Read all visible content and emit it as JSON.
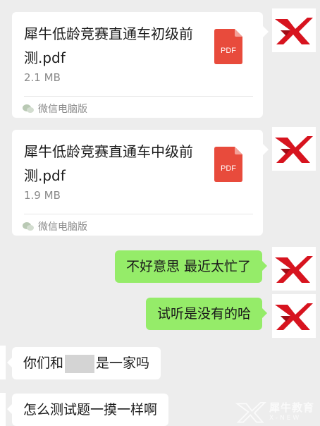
{
  "files": [
    {
      "name": "犀牛低龄竞赛直通车初级前测.pdf",
      "size": "2.1 MB",
      "source": "微信电脑版",
      "icon_label": "PDF"
    },
    {
      "name": "犀牛低龄竞赛直通车中级前测.pdf",
      "size": "1.9 MB",
      "source": "微信电脑版",
      "icon_label": "PDF"
    }
  ],
  "messages": [
    {
      "side": "right",
      "text": "不好意思 最近太忙了"
    },
    {
      "side": "right",
      "text": "试听是没有的哈"
    },
    {
      "side": "left",
      "text_before": "你们和",
      "text_after": "是一家吗"
    },
    {
      "side": "left",
      "text": "怎么测试题一摸一样啊"
    }
  ],
  "watermark": {
    "cn": "犀牛教育",
    "en": "X-NEW"
  },
  "colors": {
    "background": "#ededed",
    "sent_bubble": "#95ec69",
    "received_bubble": "#ffffff",
    "pdf_red": "#e84b3c",
    "logo_red": "#d7141f"
  }
}
